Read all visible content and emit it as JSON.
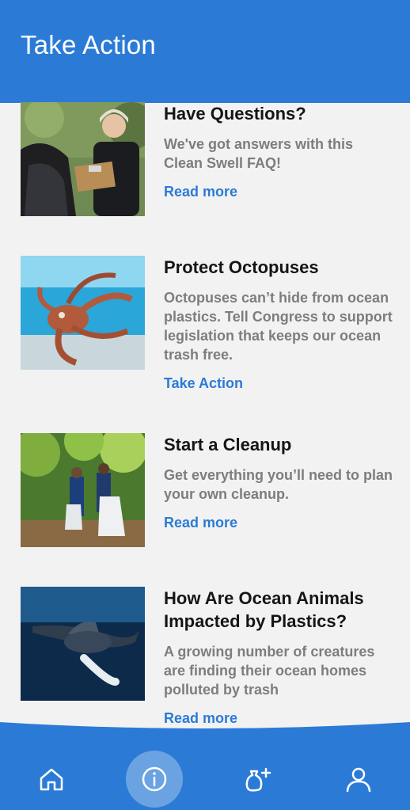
{
  "header": {
    "title": "Take Action"
  },
  "cards": [
    {
      "title": "Have Questions?",
      "description": "We've got answers with this Clean Swell FAQ!",
      "link": "Read more",
      "image": "volunteer-with-clipboard"
    },
    {
      "title": "Protect Octopuses",
      "description": "Octopuses can’t hide from ocean plastics. Tell Congress to support legislation that keeps our ocean trash free.",
      "link": "Take Action",
      "image": "octopus-underwater"
    },
    {
      "title": "Start a Cleanup",
      "description": "Get everything you’ll need to plan your own cleanup.",
      "link": "Read more",
      "image": "volunteers-cleanup-forest"
    },
    {
      "title": "How Are Ocean Animals Impacted by Plastics?",
      "description": "A growing number of creatures are finding their ocean homes polluted by trash",
      "link": "Read more",
      "image": "whale-underwater"
    }
  ],
  "nav": {
    "items": [
      {
        "name": "home",
        "icon": "home-icon",
        "active": false
      },
      {
        "name": "info",
        "icon": "info-icon",
        "active": true
      },
      {
        "name": "add-cleanup",
        "icon": "bag-plus-icon",
        "active": false
      },
      {
        "name": "profile",
        "icon": "user-icon",
        "active": false
      }
    ]
  },
  "colors": {
    "primary": "#2b7bd6",
    "background": "#f2f2f2",
    "title": "#151515",
    "description": "#7d7d7d"
  }
}
